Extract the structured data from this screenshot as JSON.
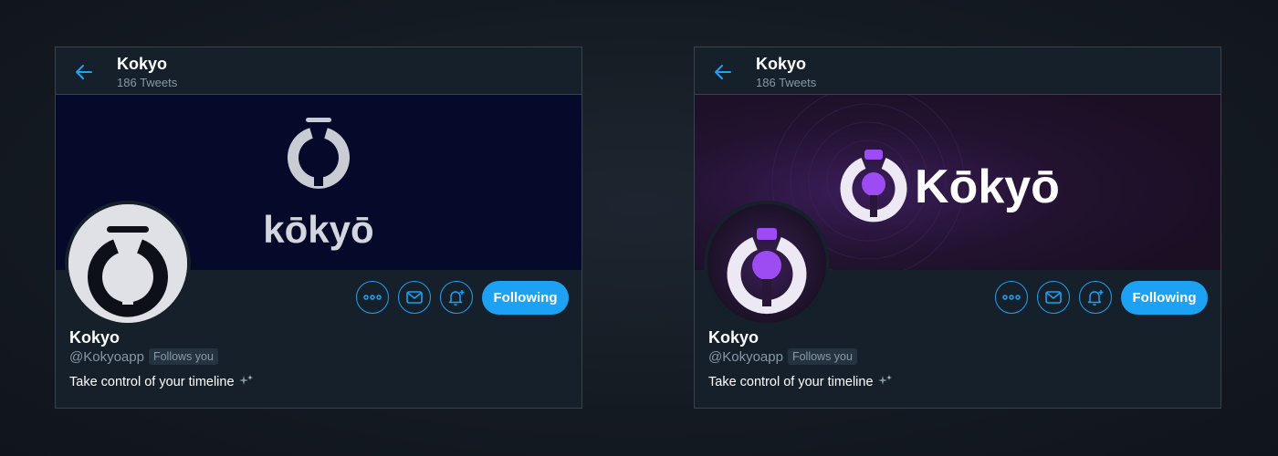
{
  "colors": {
    "accent": "#1da1f2",
    "card_bg": "#15202b",
    "border": "#38444d",
    "muted_text": "#8899a6",
    "left_banner": "#050a2b",
    "right_banner": "#1e1027",
    "purple": "#8c3af0"
  },
  "cards": [
    {
      "header": {
        "title": "Kokyo",
        "subtitle": "186 Tweets",
        "back_icon": "arrow-left-icon"
      },
      "banner": {
        "wordmark": "kōkyō"
      },
      "profile": {
        "name": "Kokyo",
        "handle": "@Kokyoapp",
        "follows_badge": "Follows you",
        "bio": "Take control of your timeline"
      },
      "actions": {
        "more_icon": "more-icon",
        "message_icon": "mail-icon",
        "notify_icon": "bell-plus-icon",
        "follow_label": "Following"
      }
    },
    {
      "header": {
        "title": "Kokyo",
        "subtitle": "186 Tweets",
        "back_icon": "arrow-left-icon"
      },
      "banner": {
        "wordmark": "Kōkyō"
      },
      "profile": {
        "name": "Kokyo",
        "handle": "@Kokyoapp",
        "follows_badge": "Follows you",
        "bio": "Take control of your timeline"
      },
      "actions": {
        "more_icon": "more-icon",
        "message_icon": "mail-icon",
        "notify_icon": "bell-plus-icon",
        "follow_label": "Following"
      }
    }
  ]
}
